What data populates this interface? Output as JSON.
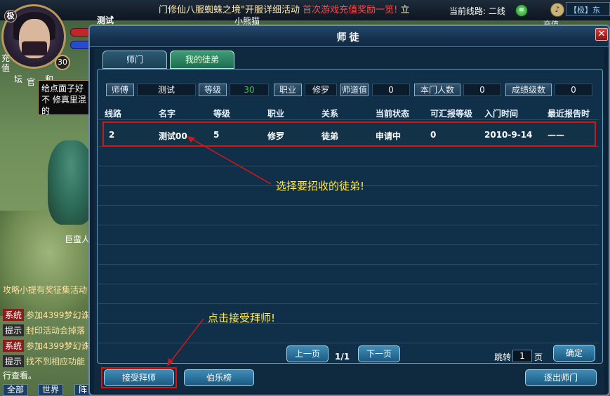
{
  "hud": {
    "marquee_prefix": "门修仙八服蜘蛛之境\"开服详细活动",
    "marquee_red": "首次游戏充值奖励一览!",
    "marquee_suffix": "立",
    "player_name": "测试",
    "npc_name": "小熊猫",
    "line_label": "当前线路: 二线",
    "server_tag": "【极】东",
    "refresh_label": "充值",
    "rank_char": "极",
    "level": "30",
    "side_recharge": "充值",
    "side_forum": "坛",
    "side_official": "官",
    "side_and": "和",
    "tooltip_text": "给点面子好不 修真里混的",
    "monster_name": "巨蛮人"
  },
  "chat": {
    "lines": [
      {
        "tag": "",
        "text": "攻略小提有奖征集活动"
      },
      {
        "tag": "系统",
        "text": "参加4399梦幻诛"
      },
      {
        "tag": "提示",
        "text": "封印活动会掉落"
      },
      {
        "tag": "系统",
        "text": "参加4399梦幻诛"
      },
      {
        "tag": "提示",
        "text": "找不到相应功能"
      },
      {
        "tag": "",
        "text": "行查看。"
      }
    ],
    "tabs": [
      "全部",
      "世界",
      "阵"
    ]
  },
  "dialog": {
    "title": "师徒",
    "tabs": {
      "sect": "师门",
      "my_disciples": "我的徒弟"
    },
    "info": {
      "master_label": "师傅",
      "master_value": "测试",
      "level_label": "等级",
      "level_value": "30",
      "job_label": "职业",
      "job_value": "修罗",
      "dao_label": "师道值",
      "dao_value": "0",
      "members_label": "本门人数",
      "members_value": "0",
      "graduates_label": "成绩级数",
      "graduates_value": "0"
    },
    "columns": [
      "线路",
      "名字",
      "等级",
      "职业",
      "关系",
      "当前状态",
      "可汇报等级",
      "入门时间",
      "最近报告时"
    ],
    "rows": [
      [
        "2",
        "测试00",
        "5",
        "修罗",
        "徒弟",
        "申请中",
        "0",
        "2010-9-14",
        "——"
      ]
    ],
    "prev_page": "上一页",
    "page_indicator": "1/1",
    "next_page": "下一页",
    "jump_label": "跳转",
    "jump_value": "1",
    "page_unit": "页",
    "confirm": "确定",
    "accept_master": "接受拜师",
    "bole_list": "伯乐榜",
    "leave_sect": "逐出师门"
  },
  "annotations": {
    "select_disciple": "选择要招收的徒弟!",
    "click_accept": "点击接受拜师!"
  },
  "colors": {
    "highlight_frame": "#d01818",
    "annotation_text": "#ffe850",
    "level_value_green": "#43c04a"
  }
}
